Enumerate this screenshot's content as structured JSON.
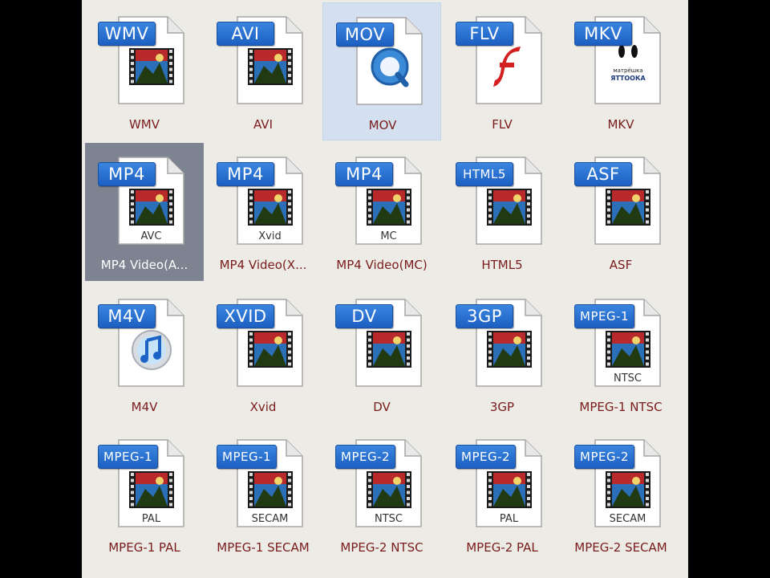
{
  "window": {
    "background": "#ecebe6",
    "selected_color": "#7d8390",
    "hover_color": "#d4e0f0"
  },
  "formats": [
    {
      "badge": "WMV",
      "caption": "WMV",
      "sub": "",
      "icon": "film-icon"
    },
    {
      "badge": "AVI",
      "caption": "AVI",
      "sub": "",
      "icon": "film-icon"
    },
    {
      "badge": "MOV",
      "caption": "MOV",
      "sub": "",
      "icon": "quicktime-icon",
      "state": "hover"
    },
    {
      "badge": "FLV",
      "caption": "FLV",
      "sub": "",
      "icon": "flash-icon"
    },
    {
      "badge": "MKV",
      "caption": "MKV",
      "sub": "",
      "icon": "matroska-icon"
    },
    {
      "badge": "MP4",
      "caption": "MP4 Video(A...",
      "sub": "AVC",
      "icon": "film-icon",
      "state": "selected"
    },
    {
      "badge": "MP4",
      "caption": "MP4 Video(X...",
      "sub": "Xvid",
      "icon": "film-icon"
    },
    {
      "badge": "MP4",
      "caption": "MP4 Video(MC)",
      "sub": "MC",
      "icon": "film-icon"
    },
    {
      "badge": "HTML5",
      "caption": "HTML5",
      "sub": "",
      "icon": "film-icon"
    },
    {
      "badge": "ASF",
      "caption": "ASF",
      "sub": "",
      "icon": "film-icon"
    },
    {
      "badge": "M4V",
      "caption": "M4V",
      "sub": "",
      "icon": "itunes-icon"
    },
    {
      "badge": "XVID",
      "caption": "Xvid",
      "sub": "",
      "icon": "film-icon"
    },
    {
      "badge": "DV",
      "caption": "DV",
      "sub": "",
      "icon": "film-icon"
    },
    {
      "badge": "3GP",
      "caption": "3GP",
      "sub": "",
      "icon": "film-icon"
    },
    {
      "badge": "MPEG-1",
      "caption": "MPEG-1 NTSC",
      "sub": "NTSC",
      "icon": "film-icon"
    },
    {
      "badge": "MPEG-1",
      "caption": "MPEG-1 PAL",
      "sub": "PAL",
      "icon": "film-icon"
    },
    {
      "badge": "MPEG-1",
      "caption": "MPEG-1 SECAM",
      "sub": "SECAM",
      "icon": "film-icon"
    },
    {
      "badge": "MPEG-2",
      "caption": "MPEG-2 NTSC",
      "sub": "NTSC",
      "icon": "film-icon"
    },
    {
      "badge": "MPEG-2",
      "caption": "MPEG-2 PAL",
      "sub": "PAL",
      "icon": "film-icon"
    },
    {
      "badge": "MPEG-2",
      "caption": "MPEG-2 SECAM",
      "sub": "SECAM",
      "icon": "film-icon"
    }
  ],
  "mkv_logo_text": "матрёшка ЯТТООКА"
}
